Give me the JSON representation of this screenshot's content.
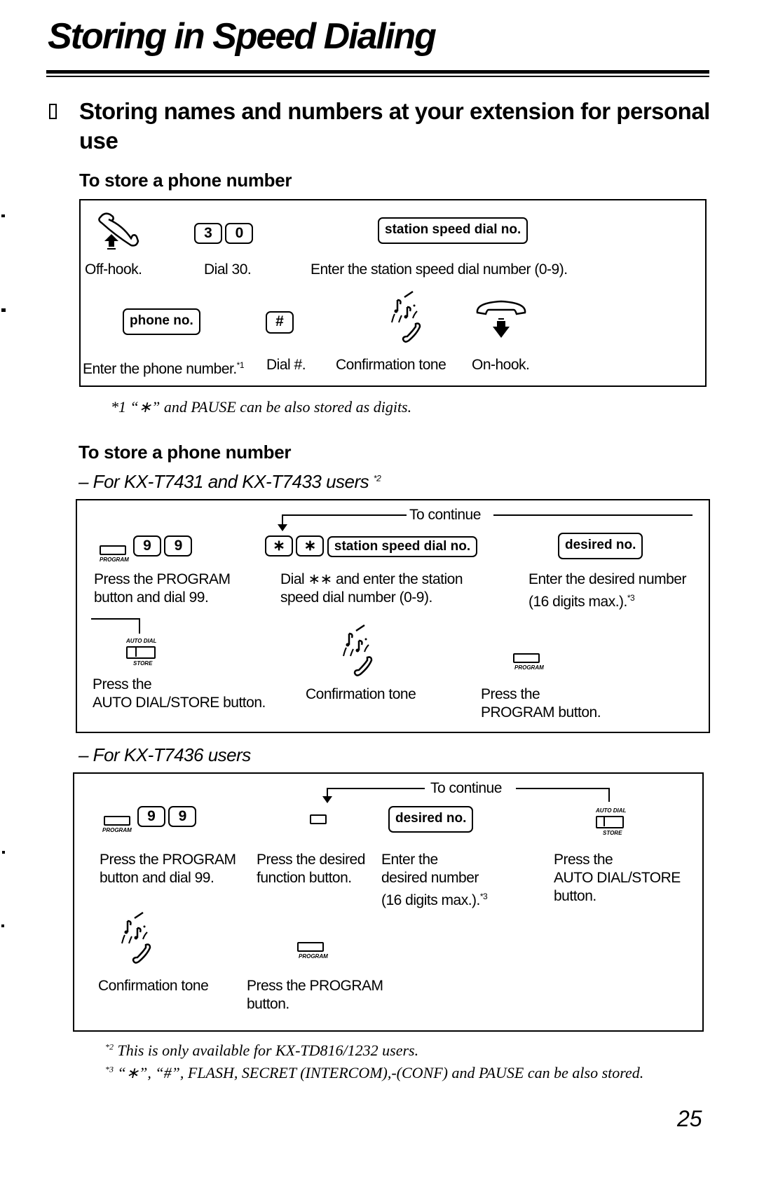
{
  "page": {
    "title": "Storing in Speed Dialing",
    "page_number": "25"
  },
  "section": {
    "heading": "Storing names and numbers at your extension for personal use"
  },
  "part1": {
    "heading": "To store a phone number",
    "steps": [
      {
        "icon": "off-hook-icon",
        "label": "Off-hook."
      },
      {
        "keys": [
          "3",
          "0"
        ],
        "label": "Dial 30."
      },
      {
        "key": "station speed dial no.",
        "label": "Enter the station speed dial number (0-9)."
      },
      {
        "key": "phone no.",
        "label": "Enter the phone number.",
        "footnote_ref": "*1"
      },
      {
        "keys": [
          "#"
        ],
        "label": "Dial #."
      },
      {
        "icon": "confirmation-tone-icon",
        "label": "Confirmation tone"
      },
      {
        "icon": "on-hook-icon",
        "label": "On-hook."
      }
    ],
    "footnote": "*1 “∗” and PAUSE  can be also stored as digits."
  },
  "part2": {
    "heading": "To store a phone number",
    "subheading": "– For KX-T7431 and KX-T7433 users",
    "subheading_ref": "*2",
    "continue_label": "To continue",
    "steps": [
      {
        "button_label": "PROGRAM",
        "keys": [
          "9",
          "9"
        ],
        "label_lines": [
          "Press the PROGRAM",
          "button and dial 99."
        ]
      },
      {
        "keys": [
          "∗",
          "∗"
        ],
        "key": "station speed dial no.",
        "label_lines": [
          "Dial ∗∗ and enter the station",
          "speed dial number (0-9)."
        ]
      },
      {
        "key": "desired no.",
        "label_lines": [
          "Enter the desired number",
          "(16 digits max.)."
        ],
        "footnote_ref": "*3"
      },
      {
        "button_top": "AUTO DIAL",
        "button_bottom": "STORE",
        "label_lines": [
          "Press the",
          "AUTO DIAL/STORE button."
        ]
      },
      {
        "icon": "confirmation-tone-icon",
        "label_lines": [
          "Confirmation tone"
        ]
      },
      {
        "button_label": "PROGRAM",
        "label_lines": [
          "Press the",
          "PROGRAM button."
        ]
      }
    ]
  },
  "part3": {
    "subheading": "– For KX-T7436 users",
    "continue_label": "To continue",
    "steps": [
      {
        "button_label": "PROGRAM",
        "keys": [
          "9",
          "9"
        ],
        "label_lines": [
          "Press the PROGRAM",
          "button and dial 99."
        ]
      },
      {
        "icon": "function-button-icon",
        "label_lines": [
          "Press the desired",
          "function button."
        ]
      },
      {
        "key": "desired no.",
        "label_lines": [
          "Enter the",
          "desired number",
          "(16 digits max.)."
        ],
        "footnote_ref": "*3"
      },
      {
        "button_top": "AUTO DIAL",
        "button_bottom": "STORE",
        "label_lines": [
          "Press the",
          "AUTO DIAL/STORE",
          "button."
        ]
      },
      {
        "icon": "confirmation-tone-icon",
        "label_lines": [
          "Confirmation tone"
        ]
      },
      {
        "button_label": "PROGRAM",
        "label_lines": [
          "Press the PROGRAM",
          "button."
        ]
      }
    ]
  },
  "footnotes": [
    {
      "ref": "*2",
      "text": "This is only available for KX-TD816/1232 users."
    },
    {
      "ref": "*3",
      "text": "“∗”, “#”, FLASH, SECRET (INTERCOM),-(CONF) and PAUSE can be also stored."
    }
  ]
}
